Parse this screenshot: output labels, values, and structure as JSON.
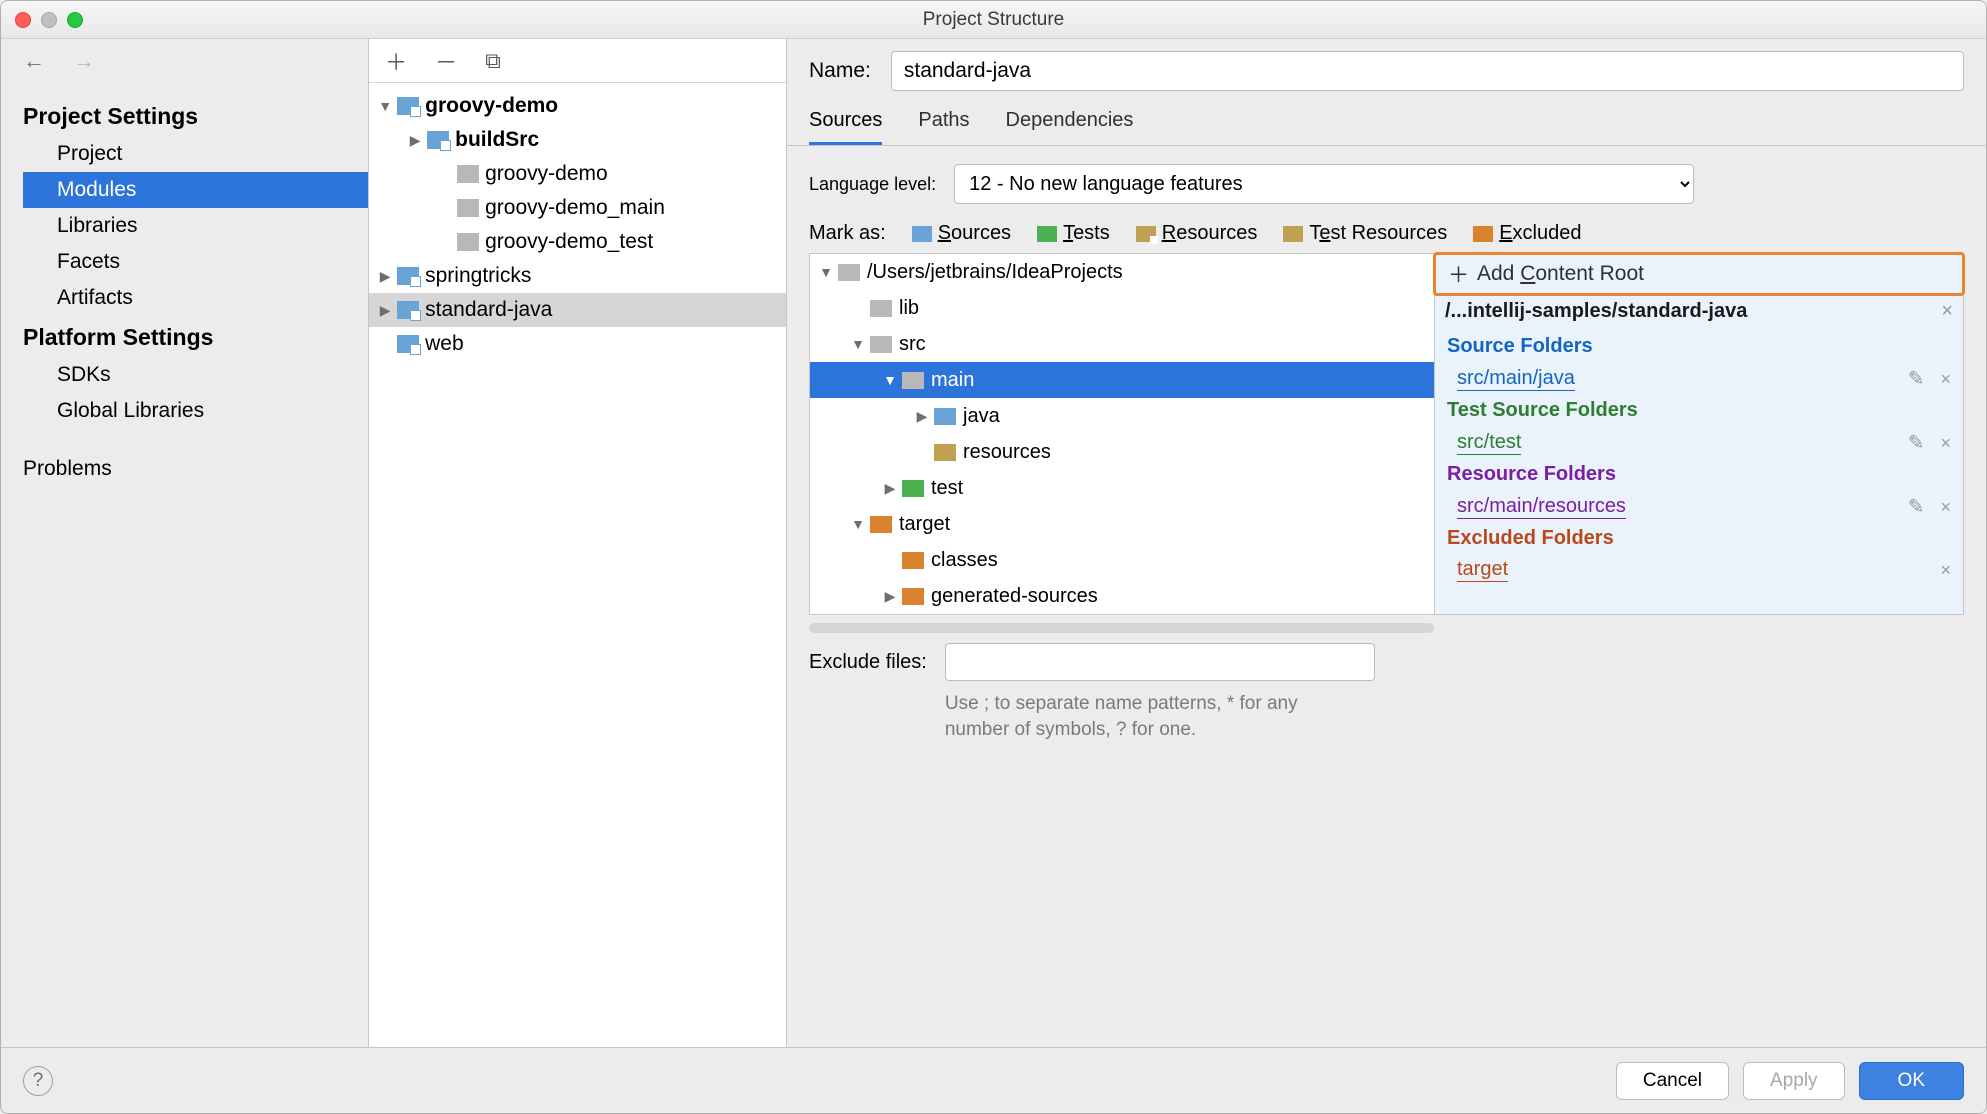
{
  "window": {
    "title": "Project Structure"
  },
  "sidebar": {
    "projectSettings": {
      "header": "Project Settings",
      "items": [
        "Project",
        "Modules",
        "Libraries",
        "Facets",
        "Artifacts"
      ],
      "selected": 1
    },
    "platformSettings": {
      "header": "Platform Settings",
      "items": [
        "SDKs",
        "Global Libraries"
      ]
    },
    "problems": "Problems"
  },
  "modules": {
    "tree": [
      {
        "label": "groovy-demo",
        "bold": true,
        "icon": "module",
        "expand": "down",
        "depth": 0
      },
      {
        "label": "buildSrc",
        "bold": true,
        "icon": "module",
        "expand": "right",
        "depth": 1
      },
      {
        "label": "groovy-demo",
        "icon": "gray",
        "depth": 2
      },
      {
        "label": "groovy-demo_main",
        "icon": "gray",
        "depth": 2
      },
      {
        "label": "groovy-demo_test",
        "icon": "gray",
        "depth": 2
      },
      {
        "label": "springtricks",
        "icon": "module",
        "expand": "right",
        "depth": 0
      },
      {
        "label": "standard-java",
        "icon": "module",
        "expand": "right",
        "depth": 0,
        "selected": true
      },
      {
        "label": "web",
        "icon": "module",
        "depth": 0
      }
    ]
  },
  "main": {
    "nameLabel": "Name:",
    "name": "standard-java",
    "tabs": [
      "Sources",
      "Paths",
      "Dependencies"
    ],
    "activeTab": 0,
    "langLabel": "Language level:",
    "langLevel": "12 - No new language features",
    "markLabel": "Mark as:",
    "markButtons": {
      "sources": "Sources",
      "tests": "Tests",
      "resources": "Resources",
      "testResources": "Test Resources",
      "excluded": "Excluded"
    },
    "srcTree": [
      {
        "label": "/Users/jetbrains/IdeaProjects",
        "icon": "gray",
        "expand": "down",
        "depth": 0
      },
      {
        "label": "lib",
        "icon": "gray",
        "depth": 1
      },
      {
        "label": "src",
        "icon": "gray",
        "expand": "down",
        "depth": 1
      },
      {
        "label": "main",
        "icon": "gray",
        "expand": "down",
        "depth": 2,
        "selected": true
      },
      {
        "label": "java",
        "icon": "blue",
        "expand": "right",
        "depth": 3
      },
      {
        "label": "resources",
        "icon": "yellow",
        "depth": 3
      },
      {
        "label": "test",
        "icon": "green",
        "expand": "right",
        "depth": 2
      },
      {
        "label": "target",
        "icon": "orange",
        "expand": "down",
        "depth": 1
      },
      {
        "label": "classes",
        "icon": "orange",
        "depth": 2
      },
      {
        "label": "generated-sources",
        "icon": "orange",
        "expand": "right",
        "depth": 2
      }
    ],
    "addContentRoot": "Add Content Root",
    "contentRootPath": "/...intellij-samples/standard-java",
    "groups": {
      "source": {
        "title": "Source Folders",
        "color": "#1565c0",
        "items": [
          "src/main/java"
        ]
      },
      "testSource": {
        "title": "Test Source Folders",
        "color": "#2e7d32",
        "items": [
          "src/test"
        ]
      },
      "resource": {
        "title": "Resource Folders",
        "color": "#7b1fa2",
        "items": [
          "src/main/resources"
        ]
      },
      "excluded": {
        "title": "Excluded Folders",
        "color": "#b9481a",
        "items": [
          "target"
        ]
      }
    },
    "excludeLabel": "Exclude files:",
    "excludeHint": "Use ; to separate name patterns, * for any number of symbols, ? for one."
  },
  "footer": {
    "cancel": "Cancel",
    "apply": "Apply",
    "ok": "OK"
  }
}
